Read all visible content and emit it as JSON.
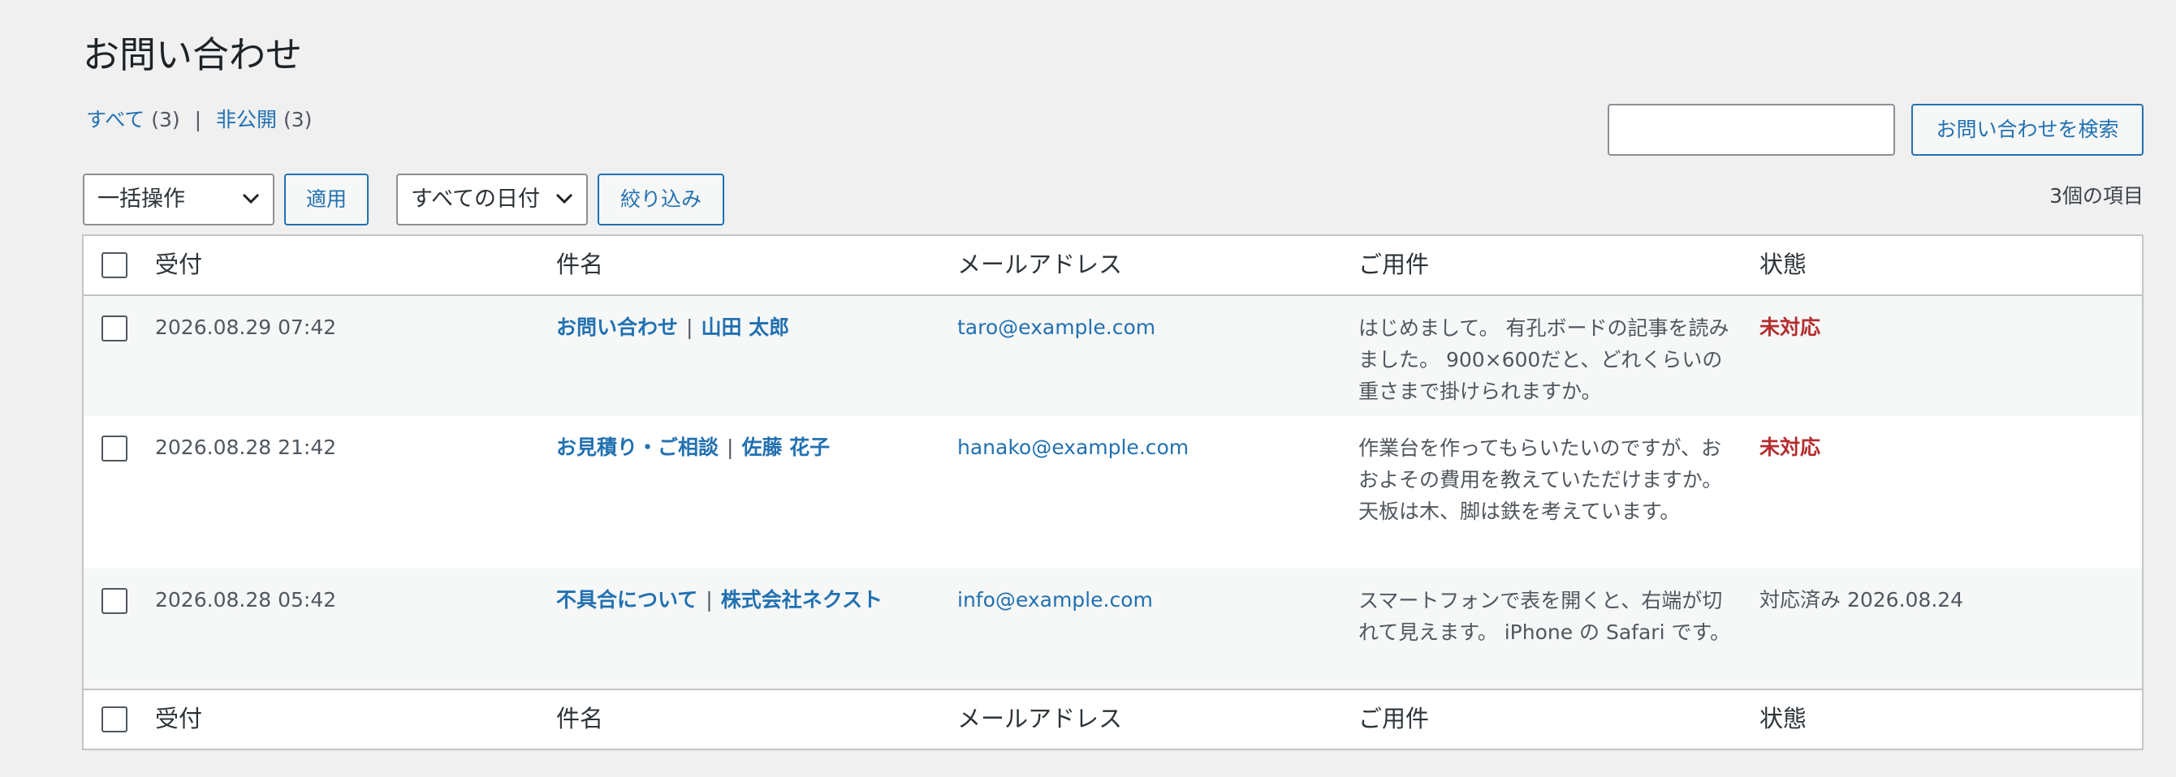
{
  "page": {
    "title": "お問い合わせ"
  },
  "filters": {
    "all_label": "すべて",
    "all_count": "(3)",
    "separator": "|",
    "private_label": "非公開",
    "private_count": "(3)"
  },
  "search": {
    "value": "",
    "button_label": "お問い合わせを検索"
  },
  "toolbar": {
    "bulk_selected": "一括操作",
    "apply_label": "適用",
    "date_selected": "すべての日付",
    "filter_label": "絞り込み",
    "item_count": "3個の項目"
  },
  "table": {
    "columns": [
      "受付",
      "件名",
      "メールアドレス",
      "ご用件",
      "状態"
    ],
    "rows": [
      {
        "date": "2026.08.29 07:42",
        "subject_type": "お問い合わせ",
        "subject_name": "山田 太郎",
        "email": "taro@example.com",
        "body": "はじめまして。 有孔ボードの記事を読みました。 900×600だと、どれくらいの重さまで掛けられますか。",
        "status": "未対応",
        "status_color": "#b32d2e"
      },
      {
        "date": "2026.08.28 21:42",
        "subject_type": "お見積り・ご相談",
        "subject_name": "佐藤 花子",
        "email": "hanako@example.com",
        "body": "作業台を作ってもらいたいのですが、おおよその費用を教えていただけますか。 天板は木、脚は鉄を考えています。",
        "status": "未対応",
        "status_color": "#b32d2e"
      },
      {
        "date": "2026.08.28 05:42",
        "subject_type": "不具合について",
        "subject_name": "株式会社ネクスト",
        "email": "info@example.com",
        "body": "スマートフォンで表を開くと、右端が切れて見えます。 iPhone の Safari です。",
        "status": "対応済み 2026.08.24",
        "status_color": "#50575e"
      }
    ],
    "subject_separator": "|"
  },
  "colors": {
    "link": "#2271b1",
    "alert": "#b32d2e",
    "background": "#f0f0f1"
  }
}
